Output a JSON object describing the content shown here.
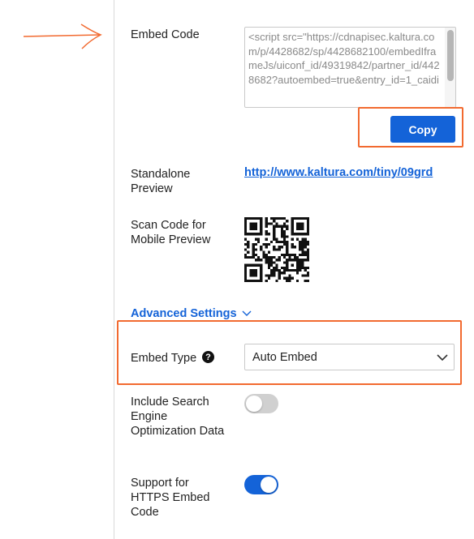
{
  "embed_code": {
    "label": "Embed Code",
    "code": "<script src=\"https://cdnapisec.kaltura.com/p/4428682/sp/4428682100/embedIframeJs/uiconf_id/49319842/partner_id/4428682?autoembed=true&entry_id=1_caidi",
    "copy_label": "Copy"
  },
  "standalone": {
    "label": "Standalone Preview",
    "url": "http://www.kaltura.com/tiny/09grd"
  },
  "scan": {
    "label": "Scan Code for Mobile Preview",
    "icon": "qr-code-icon"
  },
  "advanced": {
    "label": "Advanced Settings",
    "icon": "chevron-down-icon"
  },
  "embed_type": {
    "label": "Embed Type",
    "help_icon": "help-icon",
    "selected": "Auto Embed"
  },
  "seo": {
    "label": "Include Search Engine Optimization Data",
    "enabled": false
  },
  "https": {
    "label": "Support for HTTPS Embed Code",
    "enabled": true
  },
  "colors": {
    "accent": "#1463d8",
    "annotation": "#f26a30"
  }
}
